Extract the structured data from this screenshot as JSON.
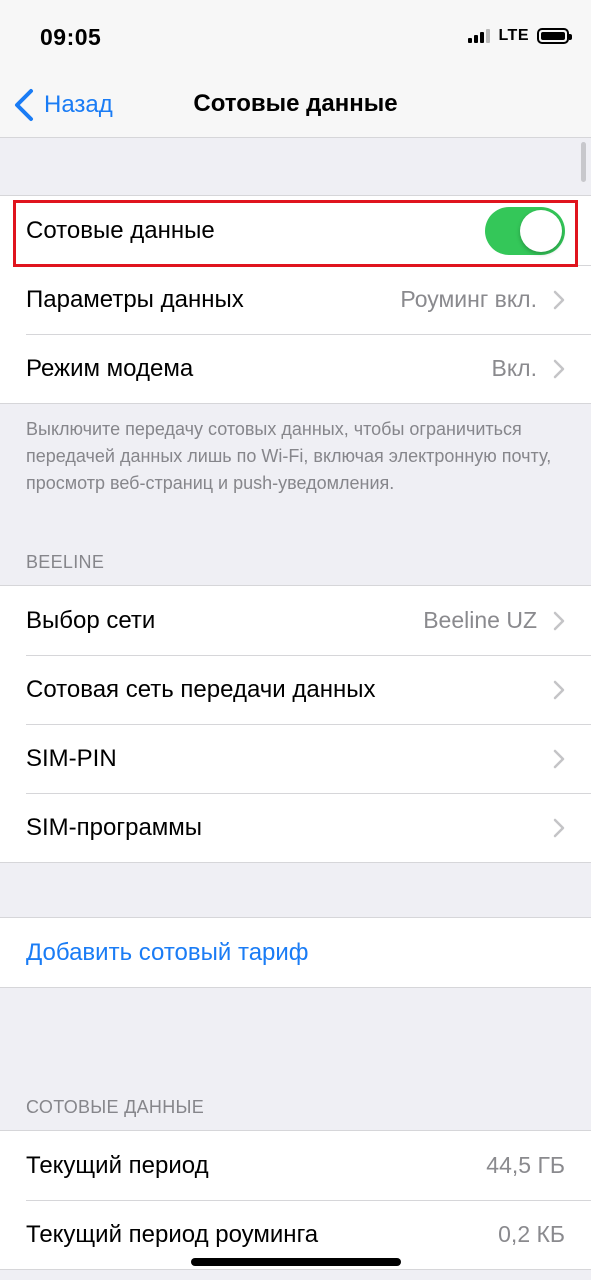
{
  "status_bar": {
    "time": "09:05",
    "network": "LTE"
  },
  "nav": {
    "back_label": "Назад",
    "title": "Сотовые данные"
  },
  "main_group": {
    "cellular_data": {
      "label": "Сотовые данные",
      "toggle_on": true
    },
    "data_options": {
      "label": "Параметры данных",
      "value": "Роуминг вкл."
    },
    "hotspot": {
      "label": "Режим модема",
      "value": "Вкл."
    }
  },
  "footnote": "Выключите передачу сотовых данных, чтобы ограничиться передачей данных лишь по Wi‑Fi, включая электронную почту, просмотр веб‑страниц и push‑уведомления.",
  "carrier_section": {
    "header": "BEELINE",
    "rows": [
      {
        "label": "Выбор сети",
        "value": "Beeline UZ"
      },
      {
        "label": "Сотовая сеть передачи данных",
        "value": ""
      },
      {
        "label": "SIM-PIN",
        "value": ""
      },
      {
        "label": "SIM-программы",
        "value": ""
      }
    ]
  },
  "add_plan": {
    "label": "Добавить сотовый тариф"
  },
  "usage_section": {
    "header": "СОТОВЫЕ ДАННЫЕ",
    "rows": [
      {
        "label": "Текущий период",
        "value": "44,5 ГБ"
      },
      {
        "label": "Текущий период роуминга",
        "value": "0,2 КБ"
      }
    ]
  },
  "colors": {
    "accent": "#1a7cf5",
    "toggle_on": "#34c759",
    "highlight": "#e0141e"
  }
}
